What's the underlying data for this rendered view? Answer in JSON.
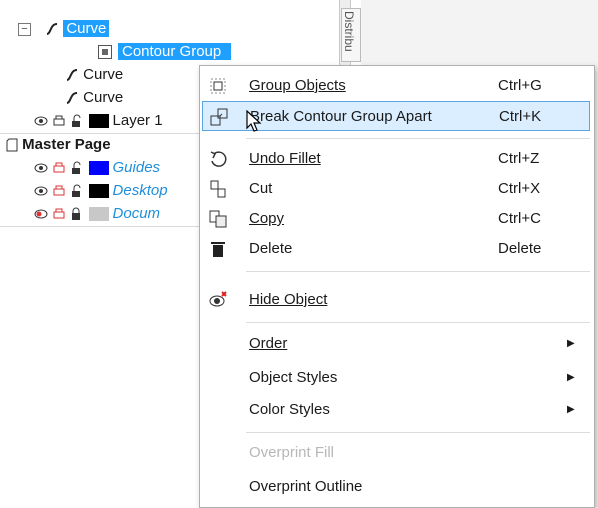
{
  "tree": {
    "curve_selected": "Curve",
    "contour_group": "Contour Group",
    "curve_a": "Curve",
    "curve_b": "Curve",
    "layer1": "Layer 1",
    "master_page": "Master Page",
    "guides": "Guides",
    "desktop": "Desktop",
    "document": "Docum",
    "side_tab": "Distribu",
    "colors": {
      "guides_swatch": "#0000ff",
      "layer_swatch": "#000000",
      "desktop_swatch": "#000000",
      "doc_swatch": "#c8c8c8",
      "selection": "#1fa0ff"
    }
  },
  "menu": {
    "group_objects": {
      "label": "Group Objects",
      "shortcut": "Ctrl+G",
      "icon": "group-objects-icon"
    },
    "break_apart": {
      "label": "Break Contour Group Apart",
      "shortcut": "Ctrl+K",
      "icon": "break-apart-icon"
    },
    "undo_fillet": {
      "label": "Undo Fillet",
      "shortcut": "Ctrl+Z",
      "icon": "undo-icon"
    },
    "cut": {
      "label": "Cut",
      "shortcut": "Ctrl+X",
      "icon": "cut-icon"
    },
    "copy": {
      "label": "Copy",
      "shortcut": "Ctrl+C",
      "icon": "copy-icon"
    },
    "delete": {
      "label": "Delete",
      "shortcut": "Delete",
      "icon": "trash-icon"
    },
    "hide_object": {
      "label": "Hide Object",
      "icon": "hide-eye-icon"
    },
    "order": {
      "label": "Order"
    },
    "object_styles": {
      "label": "Object Styles"
    },
    "color_styles": {
      "label": "Color Styles"
    },
    "overprint_fill": {
      "label": "Overprint Fill"
    },
    "overprint_outline": {
      "label": "Overprint Outline"
    }
  }
}
